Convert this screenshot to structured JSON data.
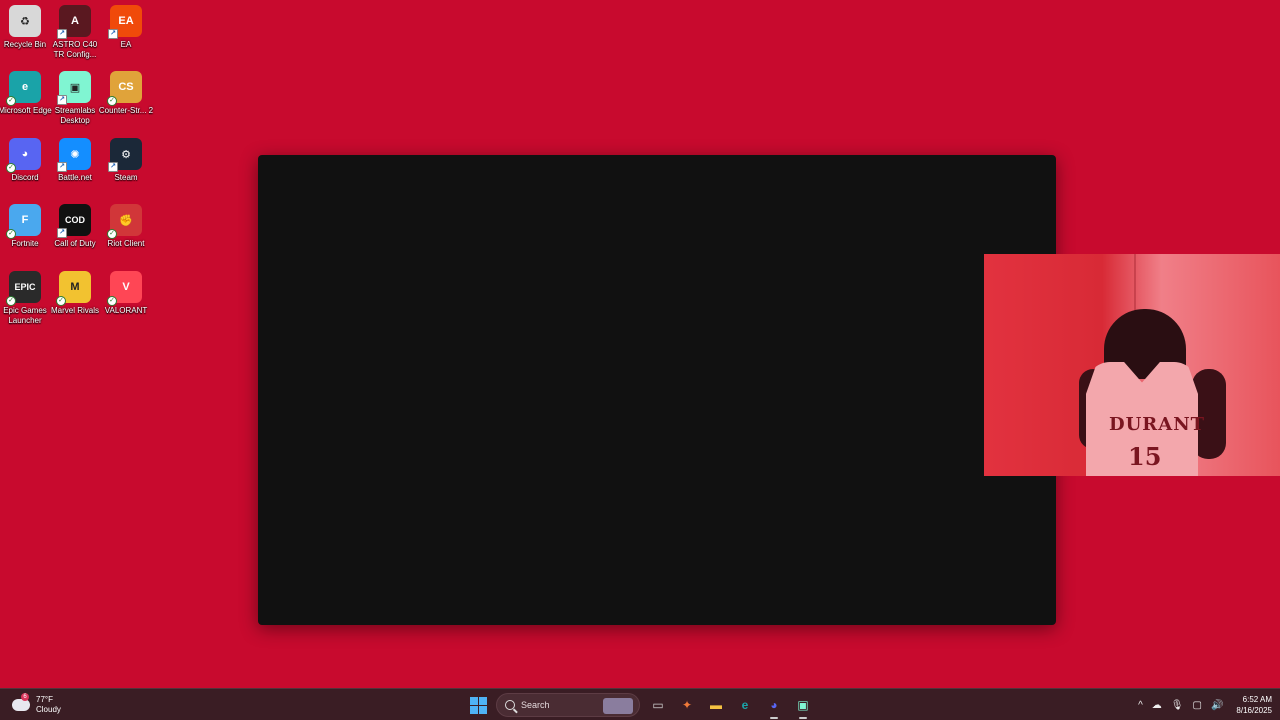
{
  "desktop_icons": [
    {
      "label": "Recycle Bin",
      "icon": "recycle-bin-icon",
      "color": "#d8d8d8",
      "glyph": "♻"
    },
    {
      "label": "ASTRO C40 TR Config...",
      "icon": "astro-controller-icon",
      "color": "#5a1820",
      "glyph": "A"
    },
    {
      "label": "EA",
      "icon": "ea-icon",
      "color": "#f04a0a",
      "glyph": "EA"
    },
    {
      "label": "Microsoft Edge",
      "icon": "edge-icon",
      "color": "#1aa3a8",
      "glyph": "e"
    },
    {
      "label": "Streamlabs Desktop",
      "icon": "streamlabs-icon",
      "color": "#80f5d2",
      "glyph": "▣"
    },
    {
      "label": "Counter-Str... 2",
      "icon": "counter-strike-icon",
      "color": "#e0a33a",
      "glyph": "CS"
    },
    {
      "label": "Discord",
      "icon": "discord-icon",
      "color": "#5865f2",
      "glyph": "◕"
    },
    {
      "label": "Battle.net",
      "icon": "battlenet-icon",
      "color": "#148eff",
      "glyph": "✺"
    },
    {
      "label": "Steam",
      "icon": "steam-icon",
      "color": "#1b2838",
      "glyph": "⚙"
    },
    {
      "label": "Fortnite",
      "icon": "fortnite-icon",
      "color": "#4aa8ee",
      "glyph": "F"
    },
    {
      "label": "Call of Duty",
      "icon": "call-of-duty-icon",
      "color": "#111111",
      "glyph": "COD"
    },
    {
      "label": "Riot Client",
      "icon": "riot-client-icon",
      "color": "#d13639",
      "glyph": "✊"
    },
    {
      "label": "Epic Games Launcher",
      "icon": "epic-games-icon",
      "color": "#2a2a2a",
      "glyph": "EPIC"
    },
    {
      "label": "Marvel Rivals",
      "icon": "marvel-rivals-icon",
      "color": "#f2c230",
      "glyph": "M"
    },
    {
      "label": "VALORANT",
      "icon": "valorant-icon",
      "color": "#ff4655",
      "glyph": "V"
    }
  ],
  "webcam": {
    "jersey_text": "DURANT",
    "jersey_number": "15"
  },
  "taskbar": {
    "weather": {
      "temp": "77°F",
      "condition": "Cloudy",
      "badge": "6",
      "icon": "cloud-icon"
    },
    "search_placeholder": "Search",
    "pinned_apps": [
      {
        "name": "task-view-icon",
        "glyph": "▭",
        "color": "#cfcfcf",
        "active": false
      },
      {
        "name": "copilot-icon",
        "glyph": "✦",
        "color": "#f07a3a",
        "active": false
      },
      {
        "name": "file-explorer-icon",
        "glyph": "▬",
        "color": "#f5c242",
        "active": false
      },
      {
        "name": "edge-icon",
        "glyph": "e",
        "color": "#1aa3a8",
        "active": false
      },
      {
        "name": "discord-icon",
        "glyph": "◕",
        "color": "#5865f2",
        "active": true
      },
      {
        "name": "streamlabs-icon",
        "glyph": "▣",
        "color": "#80f5d2",
        "active": true
      }
    ],
    "tray": {
      "chevron": "^",
      "onedrive": "☁",
      "mic": "🎙",
      "display": "▢",
      "volume": "🔊"
    },
    "clock": {
      "time": "6:52 AM",
      "date": "8/16/2025"
    }
  },
  "colors": {
    "desktop_bg": "#c80a2e",
    "window_bg": "#111111",
    "taskbar_bg": "#3a1d24"
  }
}
